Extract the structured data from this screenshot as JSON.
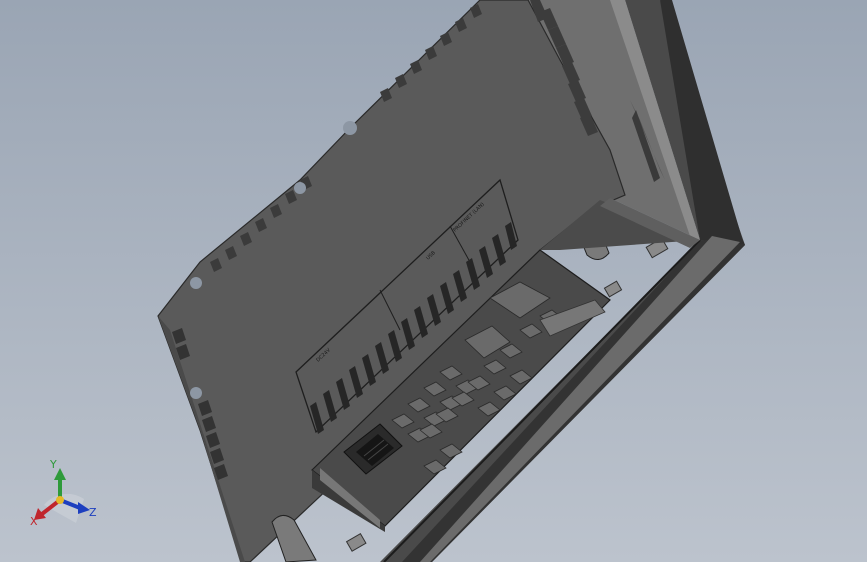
{
  "viewport": {
    "background_top": "#9aa5b4",
    "background_bottom": "#b9c1cb"
  },
  "device": {
    "name": "HMI panel rear housing",
    "body_color": "#5a5a5a",
    "panel_color": "#4d4d4d",
    "frame_color": "#3e3e3e",
    "rim_color": "#8a8a8a",
    "label_dc24v": "DC24V",
    "label_usb": "USB",
    "label_profinet": "PROFINET (LAN)"
  },
  "triad": {
    "x_label": "X",
    "y_label": "Y",
    "z_label": "Z",
    "x_color": "#c0262d",
    "y_color": "#2e9a3a",
    "z_color": "#1d3fbf"
  }
}
